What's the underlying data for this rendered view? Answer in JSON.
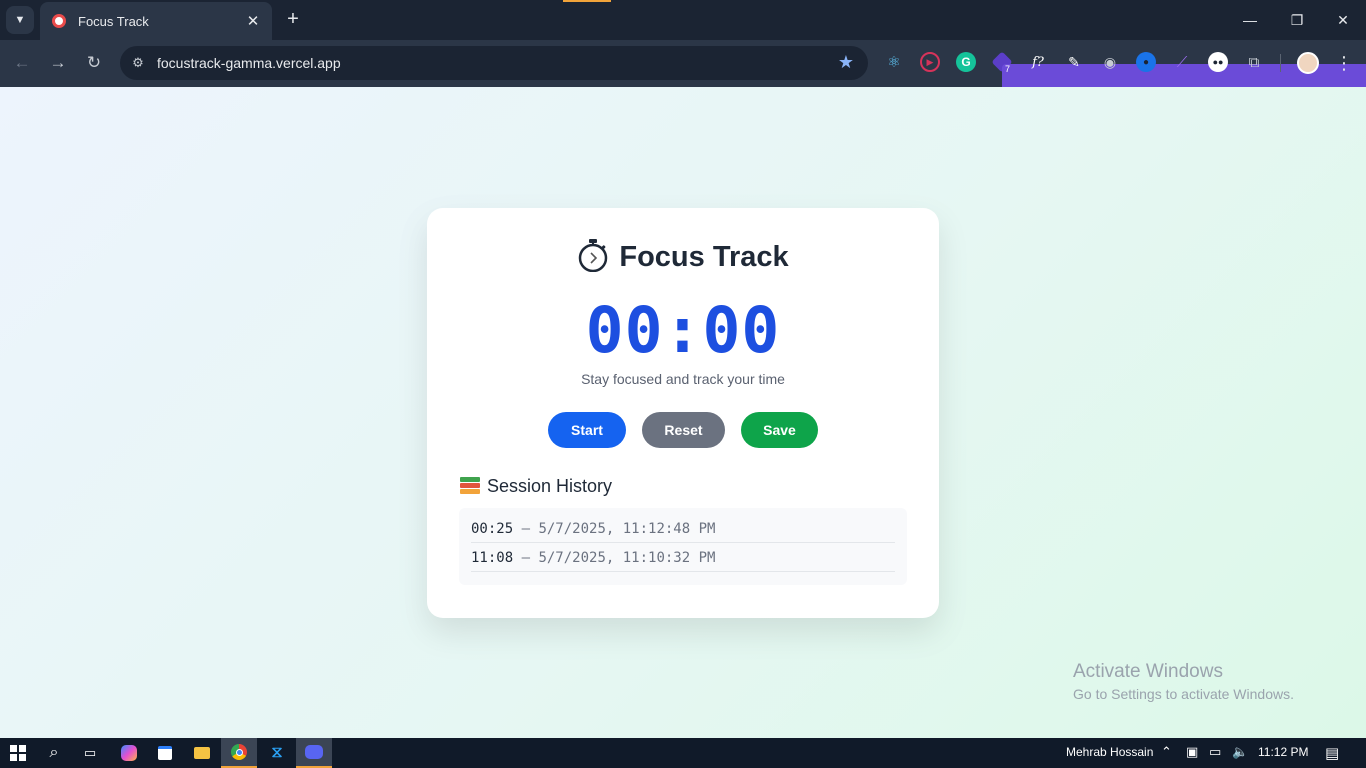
{
  "browser": {
    "tab_title": "Focus Track",
    "url": "focustrack-gamma.vercel.app",
    "extension_badge": "7",
    "extensions": [
      "react-devtools-icon",
      "screen-recorder-icon",
      "grammarly-icon",
      "extension-badge-icon",
      "font-identifier-icon",
      "color-picker-icon",
      "screenshot-icon",
      "browser-ext-icon",
      "quill-icon",
      "panda-icon",
      "extensions-puzzle-icon"
    ]
  },
  "app": {
    "title": "Focus Track",
    "timer": "00:00",
    "tagline": "Stay focused and track your time",
    "buttons": {
      "start": "Start",
      "reset": "Reset",
      "save": "Save"
    },
    "history_heading": "Session History",
    "history": [
      {
        "duration": "00:25",
        "timestamp": "– 5/7/2025, 11:12:48 PM"
      },
      {
        "duration": "11:08",
        "timestamp": "– 5/7/2025, 11:10:32 PM"
      }
    ]
  },
  "watermark": {
    "title": "Activate Windows",
    "subtitle": "Go to Settings to activate Windows."
  },
  "taskbar": {
    "user": "Mehrab Hossain",
    "time": "11:12 PM"
  },
  "colors": {
    "accent_blue": "#1d4fe0",
    "start": "#1563f0",
    "reset": "#6b7280",
    "save": "#0ea44a"
  }
}
